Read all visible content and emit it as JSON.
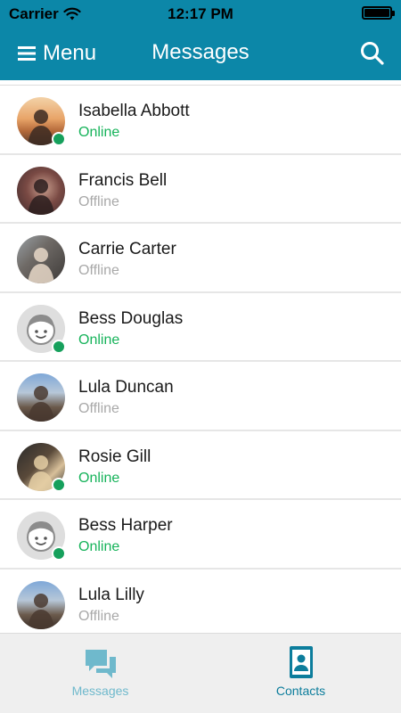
{
  "status_bar": {
    "carrier": "Carrier",
    "time": "12:17 PM"
  },
  "header": {
    "menu_label": "Menu",
    "title": "Messages",
    "menu_icon": "hamburger-icon",
    "search_icon": "search-icon"
  },
  "contacts": [
    {
      "name": "Isabella Abbott",
      "status": "Online"
    },
    {
      "name": "Francis Bell",
      "status": "Offline"
    },
    {
      "name": "Carrie Carter",
      "status": "Offline"
    },
    {
      "name": "Bess Douglas",
      "status": "Online"
    },
    {
      "name": "Lula Duncan",
      "status": "Offline"
    },
    {
      "name": "Rosie Gill",
      "status": "Online"
    },
    {
      "name": "Bess Harper",
      "status": "Online"
    },
    {
      "name": "Lula Lilly",
      "status": "Offline"
    }
  ],
  "tabs": [
    {
      "label": "Messages",
      "icon": "chat-bubbles-icon",
      "active": false
    },
    {
      "label": "Contacts",
      "icon": "contacts-icon",
      "active": true
    }
  ],
  "colors": {
    "header": "#0c87a8",
    "online": "#16b35a",
    "offline": "#a9a9a9",
    "tab_active": "#0c7d9c",
    "tab_inactive": "#6fb9cc"
  }
}
